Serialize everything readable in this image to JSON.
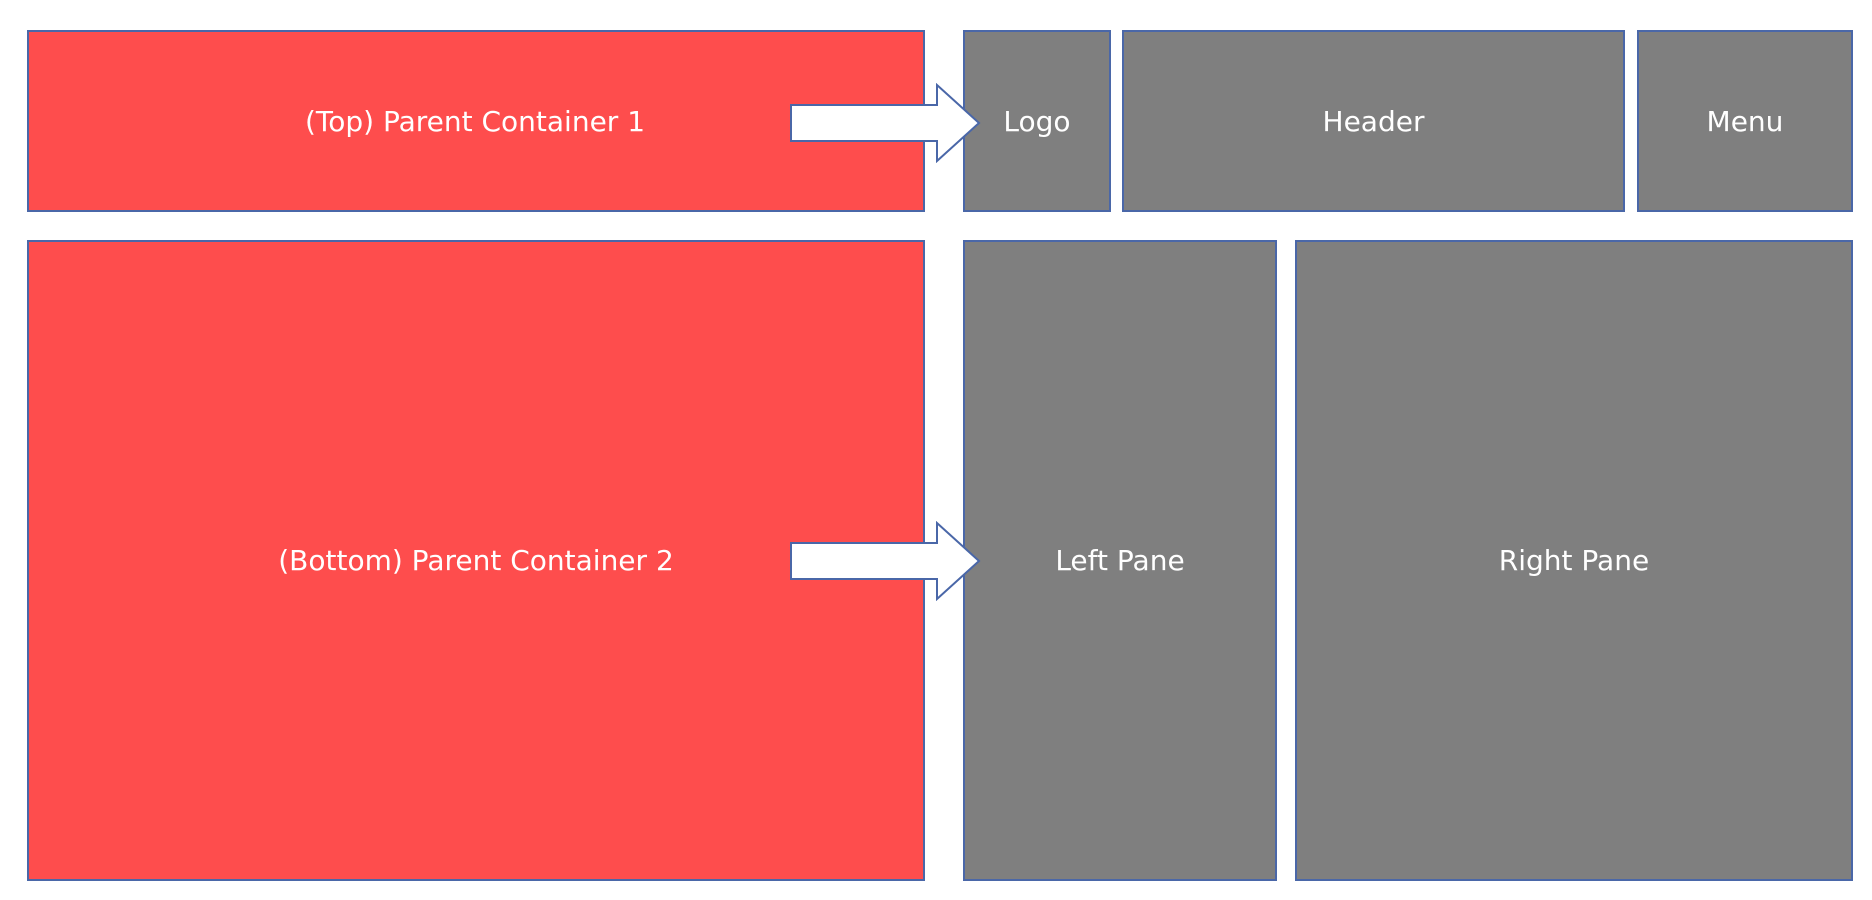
{
  "parents": {
    "top": "(Top) Parent Container 1",
    "bottom": "(Bottom) Parent Container 2"
  },
  "children": {
    "logo": "Logo",
    "header": "Header",
    "menu": "Menu",
    "left_pane": "Left Pane",
    "right_pane": "Right Pane"
  },
  "colors": {
    "parent_fill": "#fe4d4d",
    "child_fill": "#7f7f7f",
    "border": "#4a67a8",
    "arrow_fill": "#ffffff"
  }
}
